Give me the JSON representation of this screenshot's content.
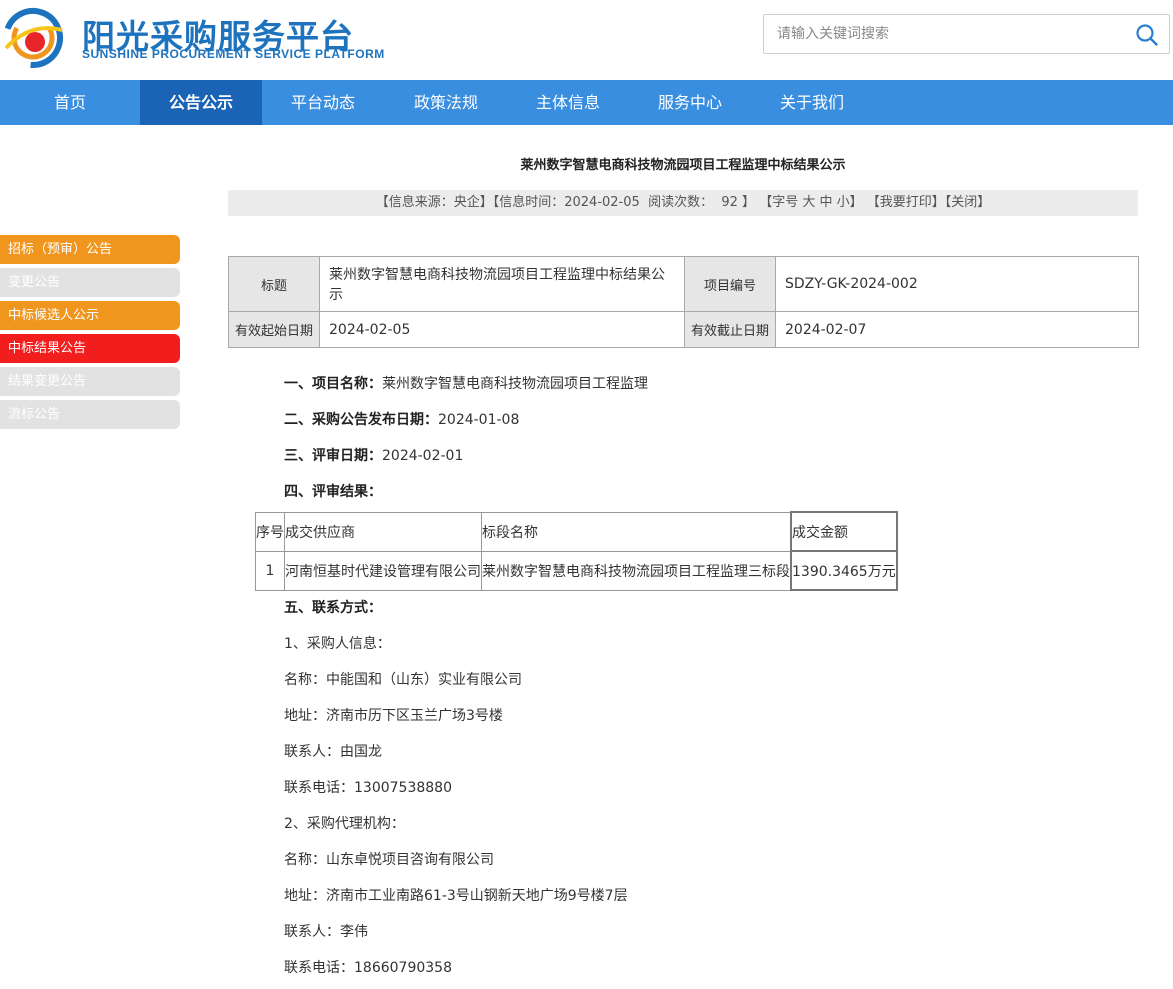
{
  "header": {
    "logo_cn": "阳光采购服务平台",
    "logo_en": "SUNSHINE PROCUREMENT SERVICE PLATFORM",
    "search_placeholder": "请输入关键词搜索"
  },
  "nav": {
    "items": [
      {
        "label": "首页"
      },
      {
        "label": "公告公示"
      },
      {
        "label": "平台动态"
      },
      {
        "label": "政策法规"
      },
      {
        "label": "主体信息"
      },
      {
        "label": "服务中心"
      },
      {
        "label": "关于我们"
      }
    ],
    "active": "公告公示"
  },
  "sidebar": {
    "items": [
      {
        "label": "招标（预审）公告"
      },
      {
        "label": "变更公告"
      },
      {
        "label": "中标候选人公示"
      },
      {
        "label": "中标结果公告"
      },
      {
        "label": "结果变更公告"
      },
      {
        "label": "流标公告"
      }
    ]
  },
  "article": {
    "title": "莱州数字智慧电商科技物流园项目工程监理中标结果公示",
    "info": {
      "source": "【信息来源：央企】",
      "time": "【信息时间：2024-02-05",
      "reads_label": "阅读次数：",
      "reads": "92",
      "reads_end": "】",
      "fontsize": "【字号 大 中 小】",
      "print": "【我要打印】",
      "close": "【关闭】"
    },
    "meta": {
      "title_label": "标题",
      "title_value": "莱州数字智慧电商科技物流园项目工程监理中标结果公示",
      "code_label": "项目编号",
      "code_value": "SDZY-GK-2024-002",
      "start_label": "有效起始日期",
      "start_value": "2024-02-05",
      "end_label": "有效截止日期",
      "end_value": "2024-02-07"
    },
    "sections": {
      "s1_label": "一、项目名称：",
      "s1_value": "莱州数字智慧电商科技物流园项目工程监理",
      "s2_label": "二、采购公告发布日期：",
      "s2_value": "2024-01-08",
      "s3_label": "三、评审日期：",
      "s3_value": "2024-02-01",
      "s4_label": "四、评审结果：",
      "s5_label": "五、联系方式："
    },
    "result_table": {
      "headers": [
        "序号",
        "成交供应商",
        "标段名称",
        "成交金额"
      ],
      "rows": [
        [
          "1",
          "河南恒基时代建设管理有限公司",
          "莱州数字智慧电商科技物流园项目工程监理三标段",
          "1390.3465万元"
        ]
      ]
    },
    "contacts": [
      "1、采购人信息：",
      "名称：中能国和（山东）实业有限公司",
      "地址：济南市历下区玉兰广场3号楼",
      "联系人：由国龙",
      "联系电话：13007538880",
      "2、采购代理机构：",
      "名称：山东卓悦项目咨询有限公司",
      "地址：济南市工业南路61-3号山钢新天地广场9号楼7层",
      "联系人：李伟",
      "联系电话：18660790358"
    ]
  },
  "colors": {
    "nav_bg": "#3a8ee0",
    "nav_active": "#1a63b5",
    "side_orange": "#f0961e",
    "side_red": "#f21d1d",
    "side_gray": "#e2e2e2"
  }
}
